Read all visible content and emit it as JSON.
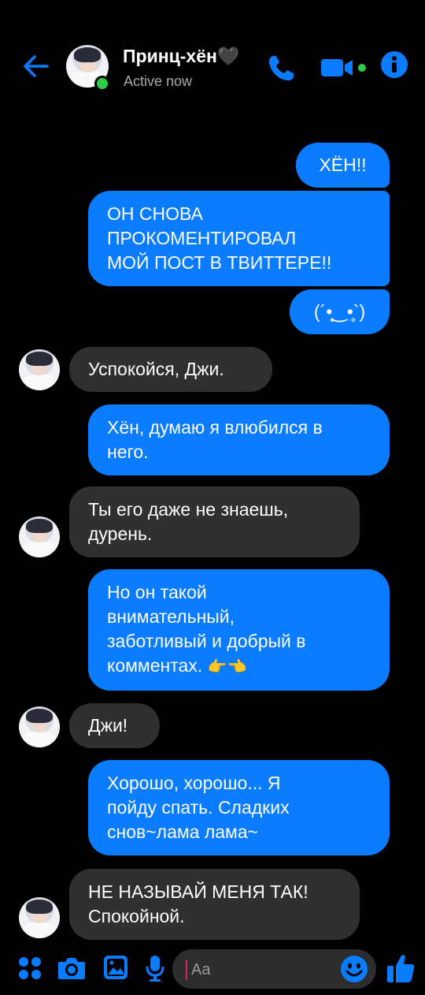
{
  "header": {
    "contact_name": "Принц-хён🖤",
    "status": "Active now"
  },
  "messages": [
    {
      "side": "sent",
      "text": "ХЁН!!"
    },
    {
      "side": "sent",
      "line1": "ОН СНОВА",
      "line2": "ПРОКОМЕНТИРОВАЛ",
      "line3": "МОЙ ПОСТ В ТВИТТЕРЕ!!"
    },
    {
      "side": "sent",
      "text": "(´•̥‿•̥`)"
    },
    {
      "side": "recv",
      "text": "Успокойся, Джи."
    },
    {
      "side": "sent",
      "line1": "Хён, думаю я влюбился в",
      "line2": "него."
    },
    {
      "side": "recv",
      "line1": "Ты его даже не знаешь,",
      "line2": "дурень."
    },
    {
      "side": "sent",
      "line1": "Но он такой",
      "line2": "внимательный,",
      "line3": "заботливый и добрый в",
      "line4": "комментах.",
      "emoji": "👉👈"
    },
    {
      "side": "recv",
      "text": "Джи!"
    },
    {
      "side": "sent",
      "line1": "Хорошо, хорошо... Я",
      "line2": "пойду спать. Сладких",
      "line3": "снов~лама лама~"
    },
    {
      "side": "recv",
      "line1": "НЕ НАЗЫВАЙ МЕНЯ ТАК!",
      "line2": "Спокойной."
    }
  ],
  "composer": {
    "placeholder": "Aa"
  },
  "colors": {
    "accent": "#0a7cff",
    "received_bubble": "#303030",
    "background": "#000000",
    "online": "#31cc46"
  },
  "icons": [
    "back-arrow-icon",
    "phone-icon",
    "video-camera-icon",
    "info-icon",
    "apps-icon",
    "camera-icon",
    "image-icon",
    "microphone-icon",
    "emoji-icon",
    "thumbs-up-icon"
  ]
}
